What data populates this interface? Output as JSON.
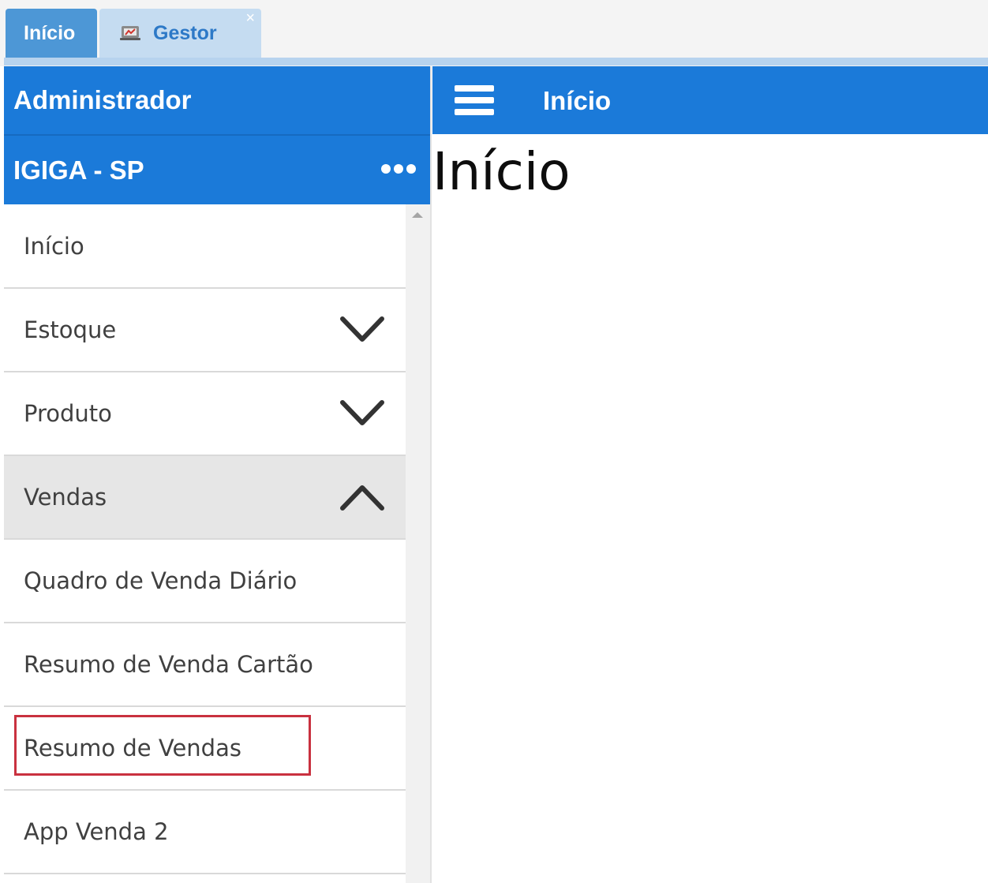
{
  "tabs": [
    {
      "label": "Início",
      "active": true
    },
    {
      "label": "Gestor",
      "icon": "gestor-icon",
      "closable": true,
      "close_label": "×"
    }
  ],
  "sidebar": {
    "title": "Administrador",
    "company": "IGIGA - SP",
    "more_icon": "ellipsis-icon",
    "items": [
      {
        "label": "Início"
      },
      {
        "label": "Estoque",
        "icon": "chevron-down-icon"
      },
      {
        "label": "Produto",
        "icon": "chevron-down-icon"
      },
      {
        "label": "Vendas",
        "icon": "chevron-up-icon",
        "expanded": true
      },
      {
        "label": "Quadro de Venda Diário"
      },
      {
        "label": "Resumo de Venda Cartão"
      },
      {
        "label": "Resumo de Vendas",
        "highlighted": true
      },
      {
        "label": "App Venda 2"
      }
    ]
  },
  "main": {
    "menu_icon": "hamburger-menu-icon",
    "header_title": "Início",
    "page_title": "Início"
  },
  "colors": {
    "primary_blue": "#1b7ad9",
    "tab_active": "#4d97d6",
    "tab_inactive": "#c5dcf1",
    "highlight_red": "#c9313f",
    "expanded_bg": "#e6e6e6"
  }
}
